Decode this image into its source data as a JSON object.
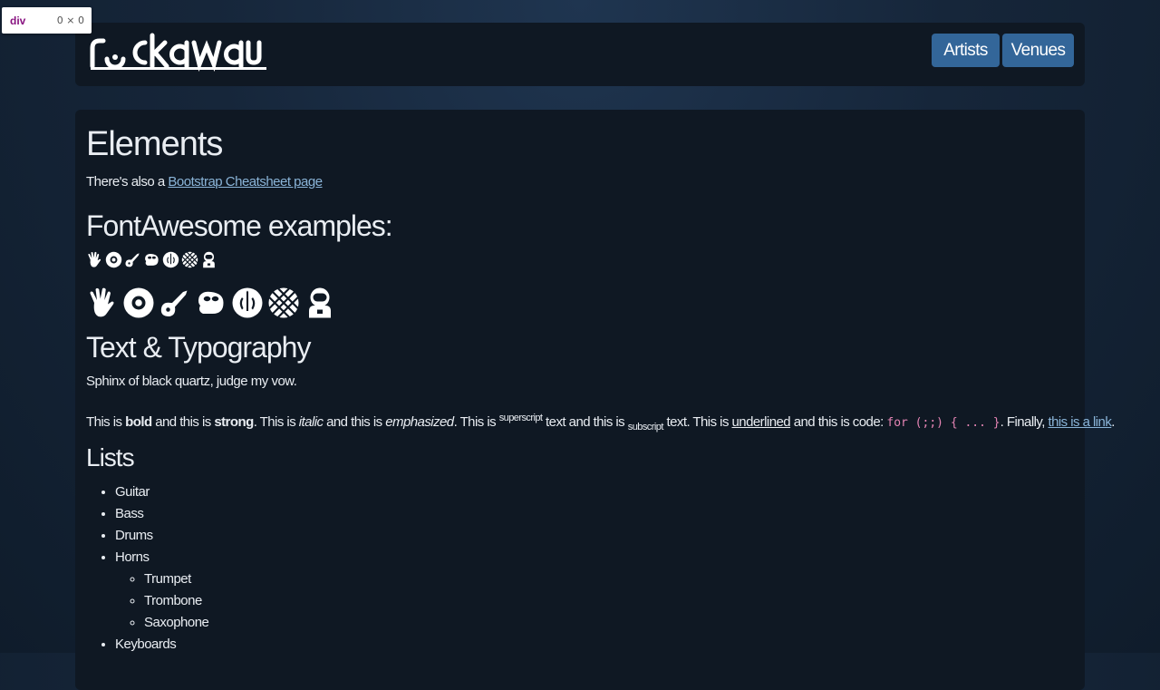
{
  "devtools_tooltip": {
    "tag": "div",
    "size": "0 × 0"
  },
  "brand": {
    "logo_text": "rockaway"
  },
  "nav": {
    "artists": "Artists",
    "venues": "Venues"
  },
  "content": {
    "title": "Elements",
    "cheatsheet_prefix": "There's also a ",
    "cheatsheet_link": "Bootstrap Cheatsheet page",
    "fa_heading": "FontAwesome examples:",
    "icons": [
      "hand-spock-icon",
      "compact-disc-icon",
      "guitar-icon",
      "sloth-icon",
      "jedi-order-icon",
      "basketball-icon",
      "astronaut-icon"
    ],
    "typography_heading": "Text & Typography",
    "pangram": "Sphinx of black quartz, judge my vow.",
    "typo": {
      "t1": "This is ",
      "bold": "bold",
      "t2": " and this is ",
      "strong": "strong",
      "t3": ". This is ",
      "italic": "italic",
      "t4": " and this is ",
      "em": "emphasized",
      "t5": ". This is ",
      "sup": "superscript",
      "t6": " text and this is ",
      "sub": "subscript",
      "t7": " text. This is ",
      "u": "underlined",
      "t8": " and this is code: ",
      "code": "for (;;) { ... }",
      "t9": ". Finally, ",
      "link": "this is a link",
      "t10": "."
    },
    "lists_heading": "Lists",
    "list_items": [
      "Guitar",
      "Bass",
      "Drums",
      "Horns",
      "Keyboards"
    ],
    "horns_sub_items": [
      "Trumpet",
      "Trombone",
      "Saxophone"
    ]
  }
}
